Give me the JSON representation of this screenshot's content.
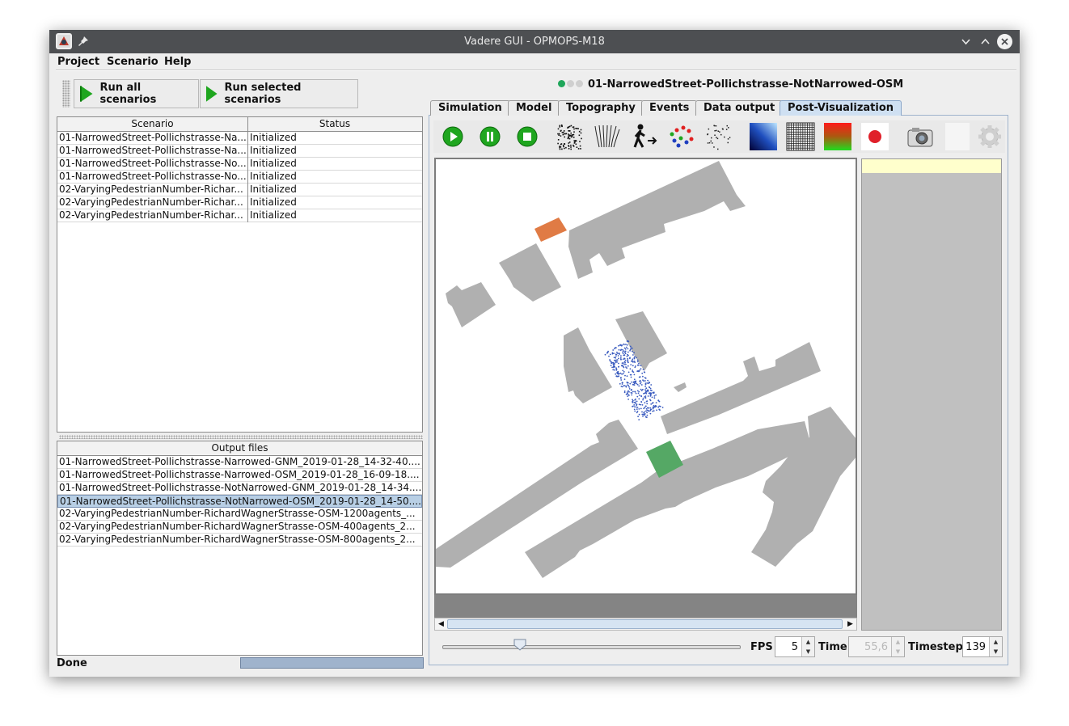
{
  "window": {
    "title": "Vadere GUI - OPMOPS-M18"
  },
  "menu": [
    "Project",
    "Scenario",
    "Help"
  ],
  "toolbar": {
    "run_all": "Run all scenarios",
    "run_selected": "Run selected scenarios"
  },
  "scenario_table": {
    "headers": [
      "Scenario",
      "Status"
    ],
    "rows": [
      [
        "01-NarrowedStreet-Pollichstrasse-Na...",
        "Initialized"
      ],
      [
        "01-NarrowedStreet-Pollichstrasse-Na...",
        "Initialized"
      ],
      [
        "01-NarrowedStreet-Pollichstrasse-No...",
        "Initialized"
      ],
      [
        "01-NarrowedStreet-Pollichstrasse-No...",
        "Initialized"
      ],
      [
        "02-VaryingPedestrianNumber-Richar...",
        "Initialized"
      ],
      [
        "02-VaryingPedestrianNumber-Richar...",
        "Initialized"
      ],
      [
        "02-VaryingPedestrianNumber-Richar...",
        "Initialized"
      ]
    ]
  },
  "output_files": {
    "header": "Output files",
    "selected_index": 3,
    "rows": [
      "01-NarrowedStreet-Pollichstrasse-Narrowed-GNM_2019-01-28_14-32-40....",
      "01-NarrowedStreet-Pollichstrasse-Narrowed-OSM_2019-01-28_16-09-18....",
      "01-NarrowedStreet-Pollichstrasse-NotNarrowed-GNM_2019-01-28_14-34....",
      "01-NarrowedStreet-Pollichstrasse-NotNarrowed-OSM_2019-01-28_14-50....",
      "02-VaryingPedestrianNumber-RichardWagnerStrasse-OSM-1200agents_...",
      "02-VaryingPedestrianNumber-RichardWagnerStrasse-OSM-400agents_2...",
      "02-VaryingPedestrianNumber-RichardWagnerStrasse-OSM-800agents_2..."
    ]
  },
  "status": {
    "text": "Done"
  },
  "scenario_title": "01-NarrowedStreet-Pollichstrasse-NotNarrowed-OSM",
  "tabs": [
    "Simulation",
    "Model",
    "Topography",
    "Events",
    "Data output",
    "Post-Visualization"
  ],
  "active_tab": "Post-Visualization",
  "vis_toolbar_icons": [
    "play-icon",
    "pause-icon",
    "stop-icon",
    "pedestrians-icon",
    "trajectories-icon",
    "walking-person-icon",
    "groups-icon",
    "density-points-icon",
    "gradient-icon",
    "grid-icon",
    "heatmap-icon",
    "record-icon",
    "camera-icon",
    "blank-icon",
    "settings-gear-icon"
  ],
  "controls": {
    "fps_label": "FPS",
    "fps_value": "5",
    "time_label": "Time",
    "time_value": "55,6",
    "timestep_label": "Timestep",
    "timestep_value": "139",
    "slider_fraction": 0.26
  },
  "colors": {
    "obstacle": "#b0b0b0",
    "source": "#e07b45",
    "target": "#55a865",
    "pedestrian": "#3a5bbf",
    "selection": "#b8cfe5"
  }
}
